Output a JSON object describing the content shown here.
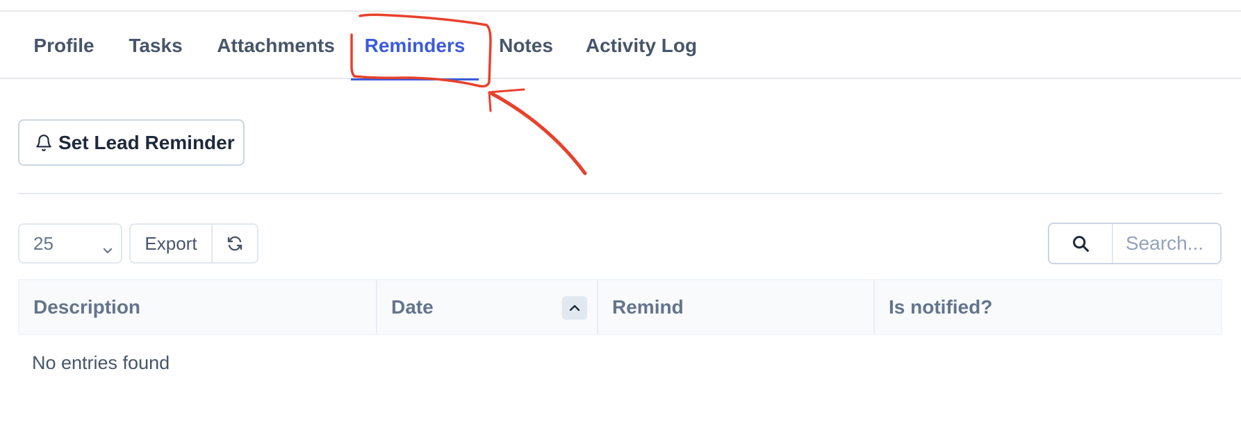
{
  "tabs": [
    {
      "label": "Profile",
      "active": false
    },
    {
      "label": "Tasks",
      "active": false
    },
    {
      "label": "Attachments",
      "active": false
    },
    {
      "label": "Reminders",
      "active": true
    },
    {
      "label": "Notes",
      "active": false
    },
    {
      "label": "Activity Log",
      "active": false
    }
  ],
  "actions": {
    "set_reminder_label": "Set Lead Reminder",
    "set_reminder_icon": "bell-icon"
  },
  "toolbar": {
    "page_length": "25",
    "export_label": "Export",
    "refresh_icon": "refresh-icon",
    "search_icon": "search-icon",
    "search_placeholder": "Search..."
  },
  "table": {
    "columns": [
      "Description",
      "Date",
      "Remind",
      "Is notified?"
    ],
    "sorted_column": "Date",
    "sort_direction": "ascending",
    "empty_message": "No entries found"
  },
  "colors": {
    "accent": "#3b5bdb",
    "annotation": "#e8412b"
  }
}
